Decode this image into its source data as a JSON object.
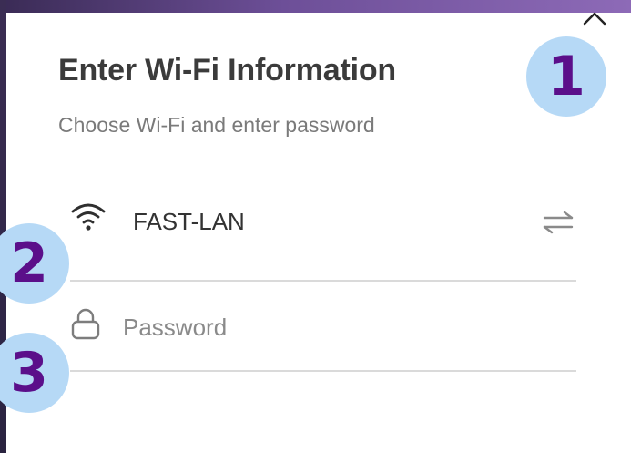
{
  "dialog": {
    "title": "Enter Wi-Fi Information",
    "subtitle": "Choose Wi-Fi and enter password",
    "close_icon": "close-icon"
  },
  "wifi": {
    "icon": "wifi-icon",
    "network_name": "FAST-LAN",
    "switch_icon": "switch-network-icon"
  },
  "password": {
    "icon": "lock-icon",
    "value": "",
    "placeholder": "Password"
  },
  "annotations": [
    {
      "label": "1"
    },
    {
      "label": "2"
    },
    {
      "label": "3"
    }
  ],
  "colors": {
    "badge_fill": "#b6d9f6",
    "badge_text": "#5b0f8a",
    "title_text": "#3b3b3b",
    "subtitle_text": "#7a7a7a",
    "divider": "#dadada",
    "header_gradient_start": "#3a2b55",
    "header_gradient_end": "#8d6ab7"
  }
}
